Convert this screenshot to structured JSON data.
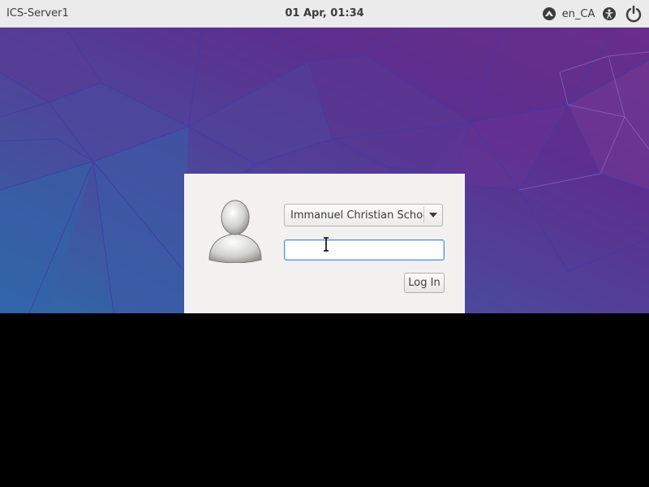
{
  "topbar": {
    "hostname": "ICS-Server1",
    "clock": "01 Apr, 01:34",
    "language": "en_CA",
    "icons": [
      "network-icon",
      "accessibility-icon",
      "power-icon"
    ]
  },
  "login": {
    "user_selected": "Immanuel Christian School",
    "password_value": "",
    "login_button": "Log In"
  },
  "colors": {
    "topbar_bg": "#ebebeb",
    "dialog_bg": "#f2f1f0",
    "wallpaper_purple": "#5b2c8c",
    "wallpaper_blue": "#2e6aa6",
    "focus_blue": "#5294e2"
  }
}
